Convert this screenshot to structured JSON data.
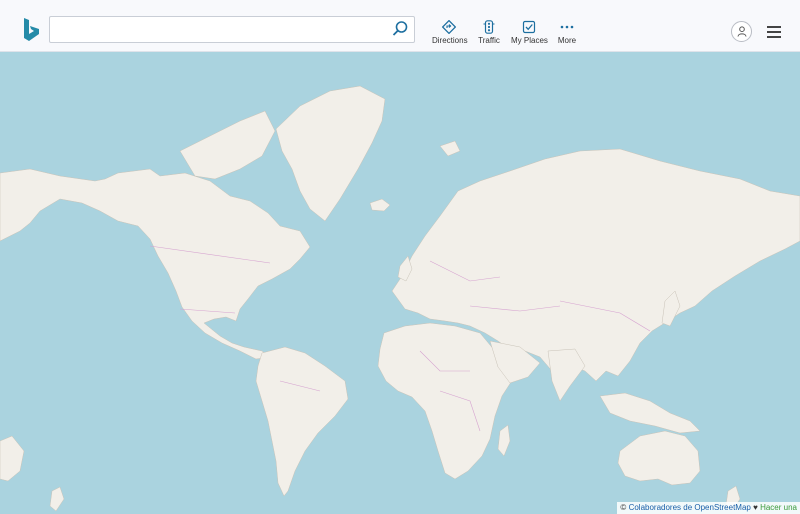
{
  "search": {
    "value": "",
    "placeholder": ""
  },
  "nav": [
    {
      "id": "directions",
      "label": "Directions",
      "icon": "directions-icon"
    },
    {
      "id": "traffic",
      "label": "Traffic",
      "icon": "traffic-icon"
    },
    {
      "id": "my_places",
      "label": "My Places",
      "icon": "my-places-icon"
    },
    {
      "id": "more",
      "label": "More",
      "icon": "more-icon"
    }
  ],
  "colors": {
    "water": "#aad3df",
    "land": "#f2efe9",
    "border": "#d6a3d0",
    "accent": "#00809d"
  },
  "attribution": {
    "copyright": "©",
    "osm_link": "Colaboradores de OpenStreetMap",
    "heart": "♥",
    "contribute_link": "Hacer una"
  }
}
